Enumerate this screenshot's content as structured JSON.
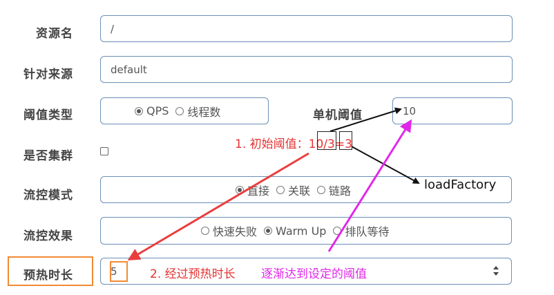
{
  "form": {
    "resource_name": {
      "label": "资源名",
      "value": "/"
    },
    "limit_app": {
      "label": "针对来源",
      "value": "default"
    },
    "grade": {
      "label": "阈值类型",
      "options": [
        "QPS",
        "线程数"
      ],
      "selected": "QPS"
    },
    "threshold": {
      "label": "单机阈值",
      "value": "10"
    },
    "cluster": {
      "label": "是否集群",
      "checked": false
    },
    "strategy": {
      "label": "流控模式",
      "options": [
        "直接",
        "关联",
        "链路"
      ],
      "selected": "直接"
    },
    "control_behavior": {
      "label": "流控效果",
      "options": [
        "快速失败",
        "Warm Up",
        "排队等待"
      ],
      "selected": "Warm Up"
    },
    "warmup": {
      "label": "预热时长",
      "value": "5"
    }
  },
  "annotations": {
    "initial_prefix": "1. 初始阈值：",
    "initial_num": "10",
    "initial_slash": "/",
    "initial_den": "3",
    "initial_result": "=3",
    "load_factor": "loadFactory",
    "warmup_note": "2. 经过预热时长",
    "gradual_note": "逐渐达到设定的阈值"
  },
  "colors": {
    "input_border": "#6a8fb8",
    "annotation_red": "#e53333",
    "annotation_magenta": "#e028e8",
    "highlight_orange": "#f08a34"
  }
}
